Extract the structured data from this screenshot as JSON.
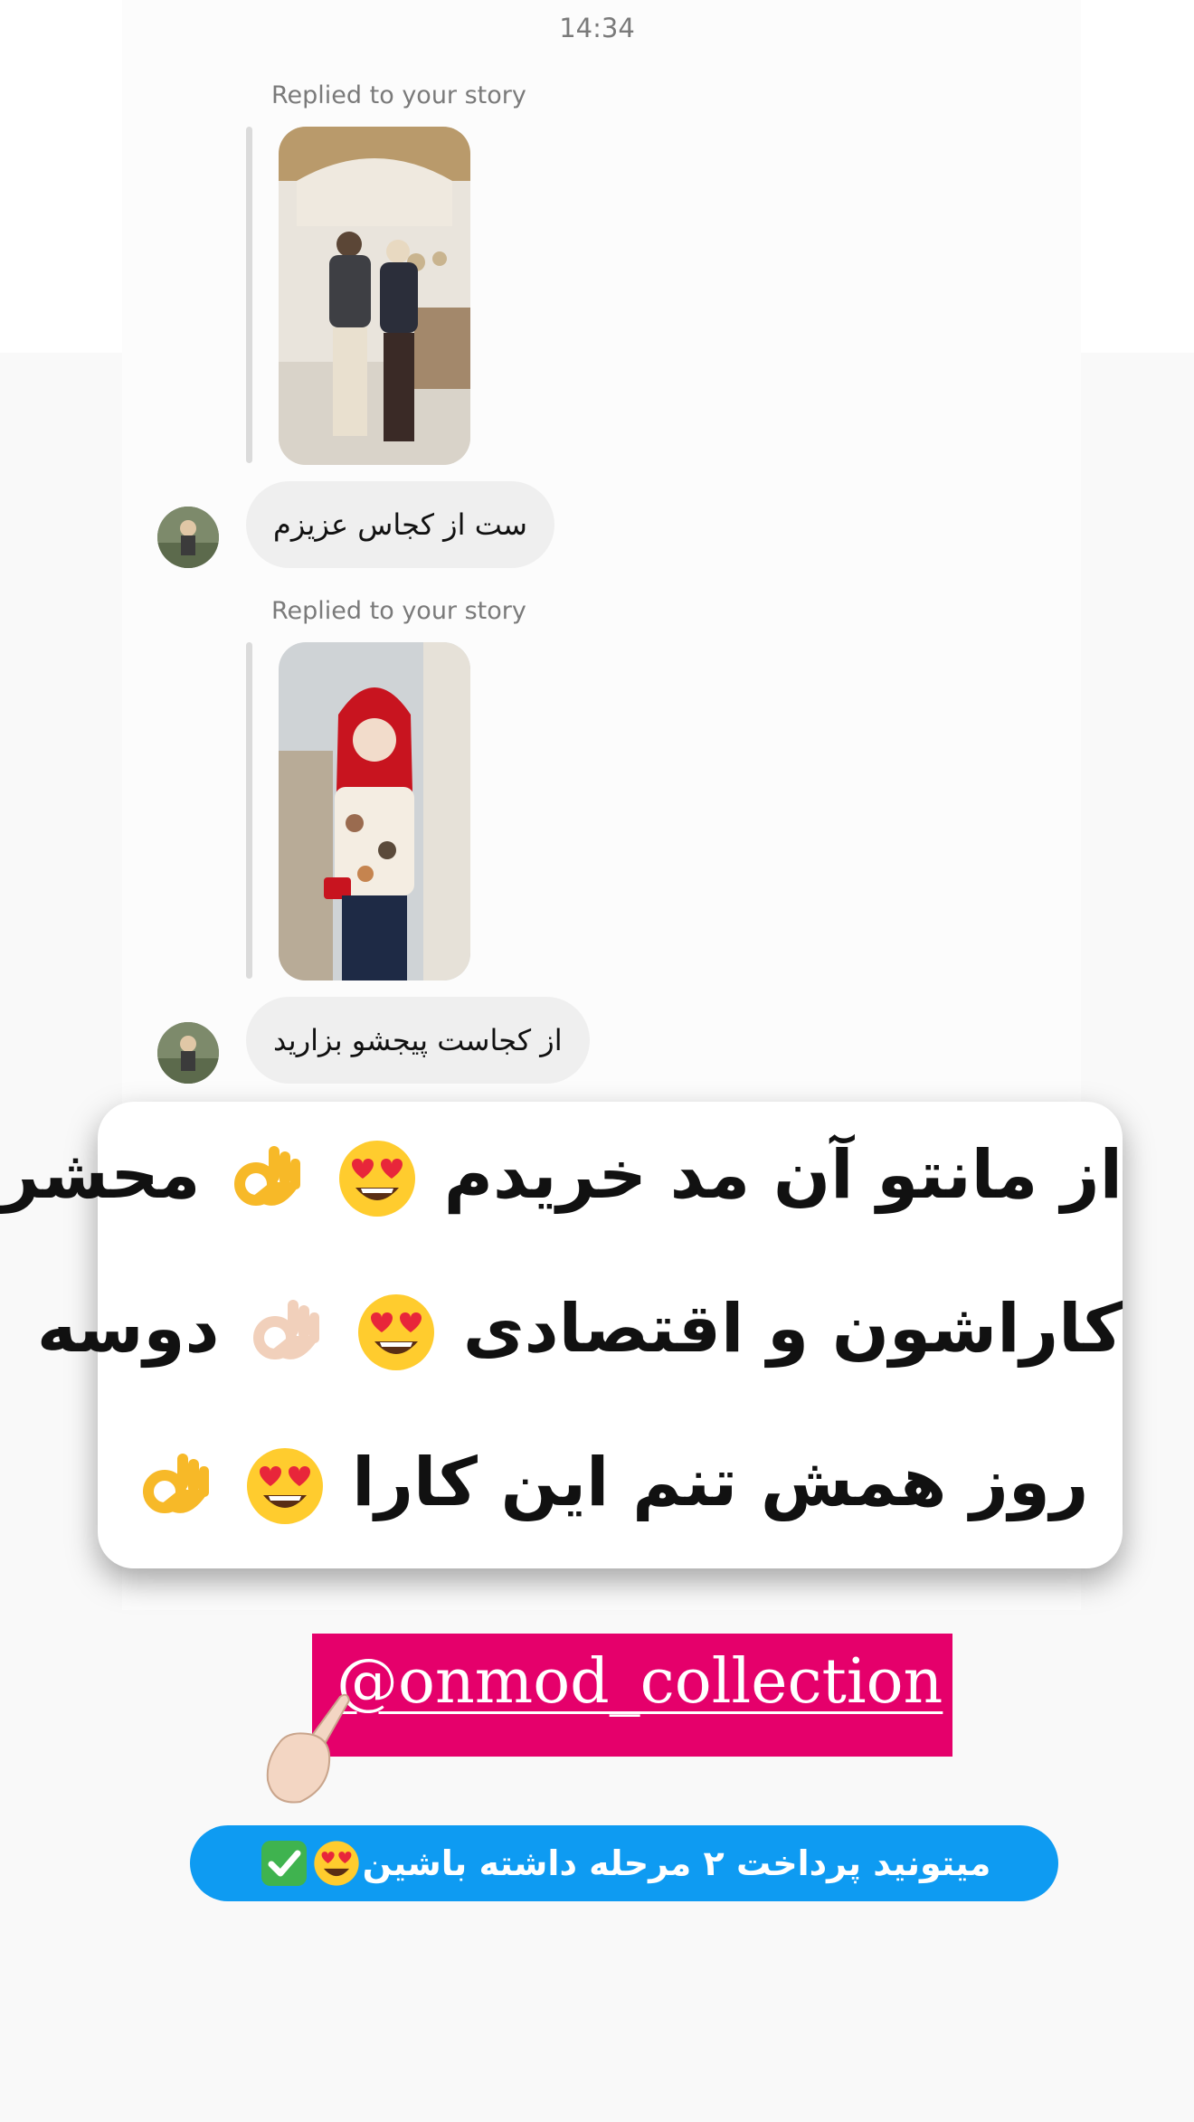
{
  "status": {
    "time": "14:34"
  },
  "thread": {
    "messages": [
      {
        "caption": "Replied to your story",
        "story_image": "story-photo-couple",
        "text": "ست از کجاس عزیزم"
      },
      {
        "caption": "Replied to your story",
        "story_image": "story-photo-woman-red-scarf",
        "text": "از کجاست پیجشو بزارید"
      }
    ]
  },
  "testimonial": {
    "line1": "از مانتو آن مد خریدم",
    "line1_end": "محشر",
    "line2": "کاراشون و اقتصادی",
    "line2_end": "دوسه",
    "line3": "روز همش تنم این کارا"
  },
  "promo": {
    "handle": "@onmod_collection",
    "handle_color": "#e5006b",
    "installment_text": "میتونید پرداخت ۲ مرحله داشته باشین",
    "installment_color": "#0e9bf2"
  },
  "icons": [
    "heart-eyes-emoji",
    "ok-hand-emoji",
    "pointing-hand-emoji",
    "check-mark-emoji"
  ]
}
